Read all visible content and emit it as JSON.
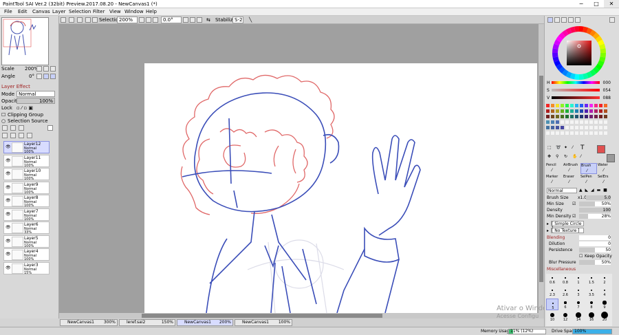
{
  "window": {
    "title": "PaintTool SAI Ver.2 (32bit) Preview.2017.08.20 - NewCanvas1 (*)",
    "min": "−",
    "max": "□",
    "close": "✕"
  },
  "menu": [
    "File",
    "Edit",
    "Canvas",
    "Layer",
    "Selection",
    "Filter",
    "View",
    "Window",
    "Help"
  ],
  "toolbar": {
    "selection_label": "Selection",
    "zoom": "200%",
    "angle": "0.0°",
    "stabilizer_label": "Stabilizer",
    "stabilizer_value": "S-2"
  },
  "left": {
    "scale_label": "Scale",
    "scale_value": "200%",
    "angle_label": "Angle",
    "angle_value": "0°",
    "layer_effect": "Layer Effect",
    "mode_label": "Mode",
    "mode_value": "Normal",
    "opacity_label": "Opacity",
    "opacity_value": "100%",
    "lock_label": "Lock",
    "clipping_group": "Clipping Group",
    "selection_source": "Selection Source",
    "layers": [
      {
        "name": "Layer12",
        "mode": "Normal",
        "opacity": "100%"
      },
      {
        "name": "Layer11",
        "mode": "Normal",
        "opacity": "100%"
      },
      {
        "name": "Layer10",
        "mode": "Normal",
        "opacity": "100%"
      },
      {
        "name": "Layer9",
        "mode": "Normal",
        "opacity": "100%"
      },
      {
        "name": "Layer8",
        "mode": "Normal",
        "opacity": "100%"
      },
      {
        "name": "Layer7",
        "mode": "Normal",
        "opacity": "100%"
      },
      {
        "name": "Layer6",
        "mode": "Normal",
        "opacity": "33%"
      },
      {
        "name": "Layer5",
        "mode": "Normal",
        "opacity": "100%"
      },
      {
        "name": "Layer4",
        "mode": "Normal",
        "opacity": "100%"
      },
      {
        "name": "Layer3",
        "mode": "Normal",
        "opacity": "15%"
      }
    ]
  },
  "tabs": [
    {
      "name": "NewCanvas1",
      "zoom": "300%"
    },
    {
      "name": "leref.sai2",
      "zoom": "150%"
    },
    {
      "name": "NewCanvas1",
      "zoom": "200%"
    },
    {
      "name": "NewCanvas1",
      "zoom": "100%"
    }
  ],
  "status": {
    "memory_label": "Memory Usage",
    "memory_value": "11% (12%)",
    "memory_fraction": 0.11,
    "drive_label": "Drive Space",
    "drive_value": "100%",
    "drive_fraction": 1.0
  },
  "watermark": {
    "line1": "Ativar o Windo",
    "line2": "Acesse Configu"
  },
  "right": {
    "h_label": "H",
    "h_value": "000",
    "s_label": "S",
    "s_value": "054",
    "v_label": "V",
    "v_value": "088",
    "accent_color": "#e05050",
    "tools": [
      "Pencil",
      "AirBrush",
      "Brush",
      "Water",
      "Marker",
      "Eraser",
      "SelPen",
      "SelErs"
    ],
    "blend_mode": "Normal",
    "brush_size_label": "Brush Size",
    "brush_size_mult": "x1.0",
    "brush_size_value": "5.0",
    "min_size_label": "Min Size",
    "min_size_value": "50%",
    "density_label": "Density",
    "density_value": "100",
    "min_density_label": "Min Density",
    "min_density_value": "28%",
    "shape": "[ Simple Circle ]",
    "texture": "[ No Texture ]",
    "blending_label": "Blending",
    "blending_value": "0",
    "dilution_label": "Dilution",
    "dilution_value": "0",
    "persistence_label": "Persistence",
    "persistence_value": "50",
    "keep_opacity": "Keep Opacity",
    "blur_pressure_label": "Blur Pressure",
    "blur_pressure_value": "50%",
    "misc_label": "Miscellaneous",
    "size_presets": [
      "0.6",
      "0.8",
      "1",
      "1.5",
      "2",
      "2.3",
      "2.6",
      "3",
      "3.5",
      "4",
      "5",
      "6",
      "7",
      "8",
      "9",
      "10",
      "12",
      "14",
      "16",
      "20"
    ]
  }
}
